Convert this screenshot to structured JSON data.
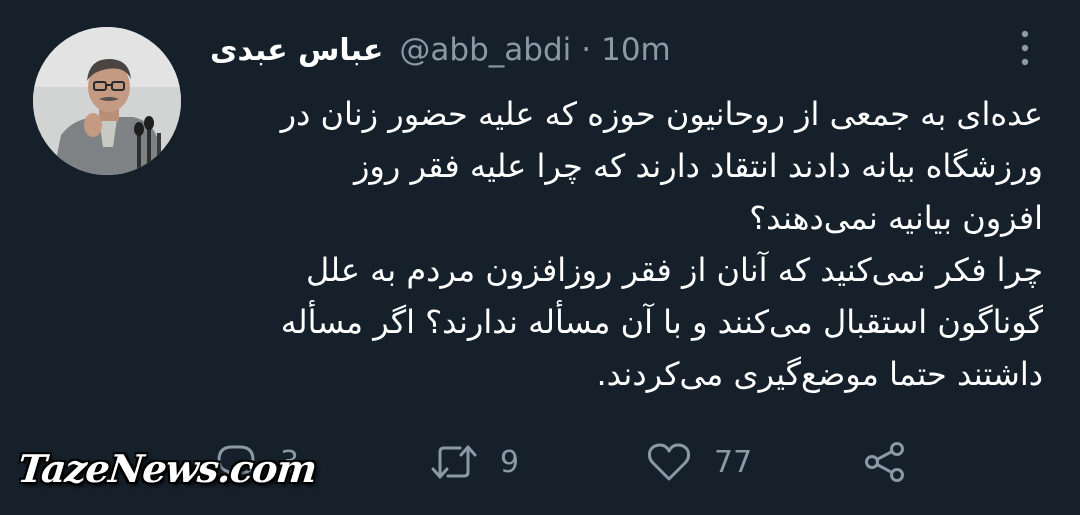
{
  "author": {
    "display_name": "عباس عبدی",
    "handle": "@abb_abdi",
    "separator": "·",
    "timestamp": "10m"
  },
  "tweet": {
    "lines": [
      "عده‌ای به جمعی از روحانیون حوزه که علیه حضور زنان در",
      "ورزشگاه بیانه دادند انتقاد دارند که چرا علیه فقر روز",
      "افزون بیانیه نمی‌دهند؟",
      "چرا فکر نمی‌کنید که آنان از فقر روزافزون مردم به علل",
      "گوناگون استقبال می‌کنند و با آن مسأله ندارند؟ اگر مسأله",
      "داشتند حتما موضع‌گیری می‌کردند."
    ]
  },
  "actions": {
    "reply_count": "3",
    "retweet_count": "9",
    "like_count": "77"
  },
  "watermark": "TazeNews.com",
  "icons": {
    "avatar": "avatar-photo",
    "more": "more-vertical-icon",
    "reply": "reply-icon",
    "retweet": "retweet-icon",
    "like": "heart-icon",
    "share": "share-icon"
  },
  "colors": {
    "background": "#15202b",
    "text": "#ffffff",
    "secondary": "#8b98a5"
  }
}
